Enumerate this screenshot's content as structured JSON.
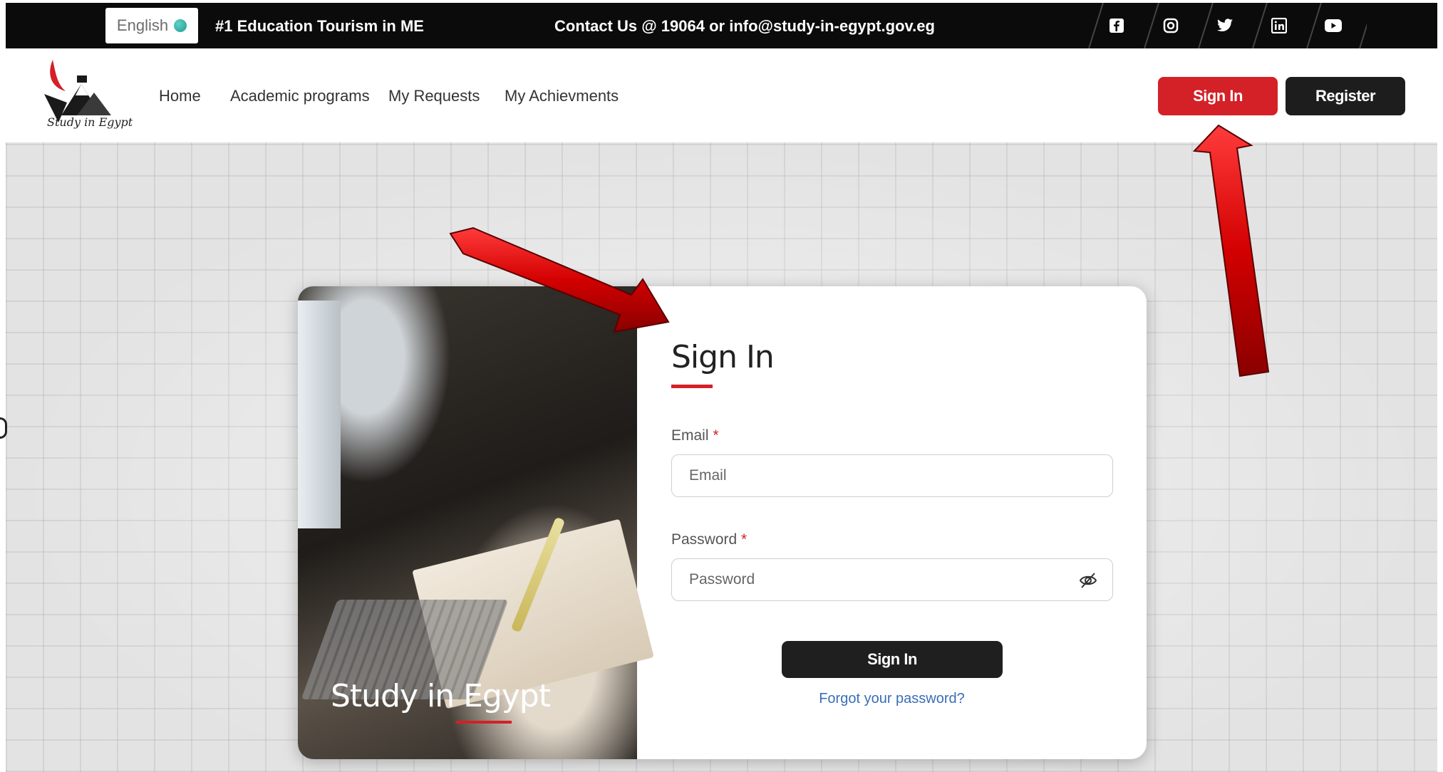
{
  "topbar": {
    "language": "English",
    "tagline": "#1 Education Tourism in ME",
    "contact": "Contact Us @ 19064 or info@study-in-egypt.gov.eg",
    "social": [
      {
        "name": "facebook-icon",
        "glyph": "f"
      },
      {
        "name": "instagram-icon",
        "glyph": "◎"
      },
      {
        "name": "twitter-icon",
        "glyph": "🐦"
      },
      {
        "name": "linkedin-icon",
        "glyph": "in"
      },
      {
        "name": "youtube-icon",
        "glyph": "▶"
      }
    ]
  },
  "nav": {
    "logo_text": "Study in Egypt",
    "links": [
      "Home",
      "Academic programs",
      "My Requests",
      "My Achievments"
    ],
    "signin_label": "Sign In",
    "register_label": "Register"
  },
  "card": {
    "photo_caption": "Study in Egypt",
    "title": "Sign In",
    "email_label": "Email",
    "email_placeholder": "Email",
    "password_label": "Password",
    "password_placeholder": "Password",
    "required_mark": "*",
    "submit_label": "Sign In",
    "forgot_label": "Forgot your password?"
  },
  "colors": {
    "accent_red": "#d42027",
    "dark": "#1d1d1d",
    "link_blue": "#3a6db8"
  }
}
